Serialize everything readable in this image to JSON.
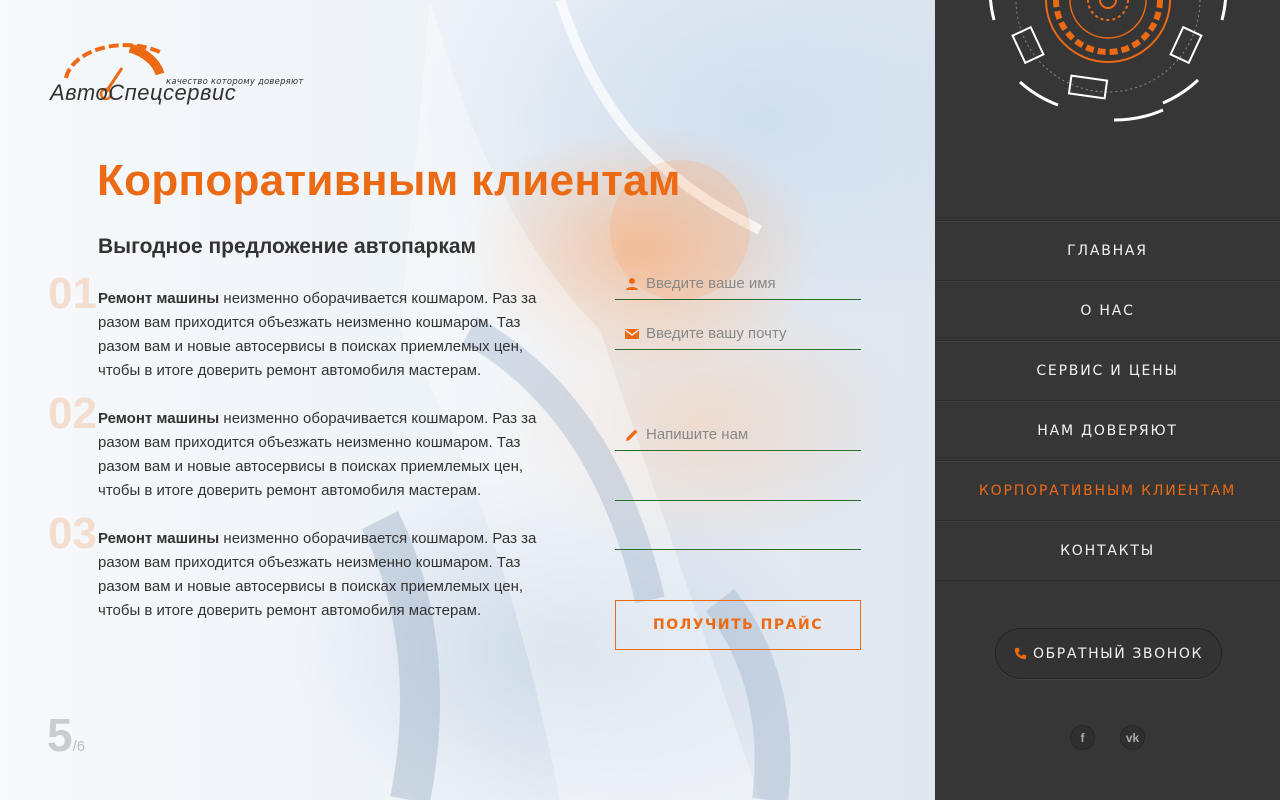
{
  "brand": {
    "name": "АвтоСпецсервис",
    "tagline": "качество которому доверяют",
    "accent": "#ec6a13",
    "dark": "#363636"
  },
  "page": {
    "title": "Корпоративным клиентам",
    "subtitle": "Выгодное предложение автопаркам"
  },
  "features": [
    {
      "number": "01",
      "bold": "Ремонт машины",
      "text": " неизменно оборачивается кошмаром. Раз за разом вам приходится объезжать неизменно кошмаром. Таз разом вам и новые автосервисы в поисках приемлемых цен, чтобы в итоге доверить ремонт автомобиля мастерам."
    },
    {
      "number": "02",
      "bold": "Ремонт машины",
      "text": " неизменно оборачивается кошмаром. Раз за разом вам приходится объезжать неизменно кошмаром. Таз разом вам и новые автосервисы в поисках приемлемых цен, чтобы в итоге доверить ремонт автомобиля мастерам."
    },
    {
      "number": "03",
      "bold": "Ремонт машины",
      "text": " неизменно оборачивается кошмаром. Раз за разом вам приходится объезжать неизменно кошмаром. Таз разом вам и новые автосервисы в поисках приемлемых цен, чтобы в итоге доверить ремонт автомобиля мастерам."
    }
  ],
  "form": {
    "name_placeholder": "Введите ваше имя",
    "email_placeholder": "Введите вашу почту",
    "message_placeholder": "Напишите нам",
    "submit_label": "ПОЛУЧИТЬ ПРАЙС",
    "icons": [
      "person-icon",
      "mail-icon",
      "pencil-icon"
    ]
  },
  "pager": {
    "current": "5",
    "total": "/6"
  },
  "menu": [
    {
      "label": "Главная",
      "active": false
    },
    {
      "label": "О нас",
      "active": false
    },
    {
      "label": "Сервис и цены",
      "active": false
    },
    {
      "label": "Нам доверяют",
      "active": false
    },
    {
      "label": "Корпоративным клиентам",
      "active": true
    },
    {
      "label": "Контакты",
      "active": false
    }
  ],
  "callback": {
    "label": "ОБРАТНЫЙ ЗВОНОК",
    "icon": "phone-icon"
  },
  "social": [
    {
      "label": "f",
      "icon": "facebook-icon"
    },
    {
      "label": "vk",
      "icon": "vk-icon"
    }
  ]
}
